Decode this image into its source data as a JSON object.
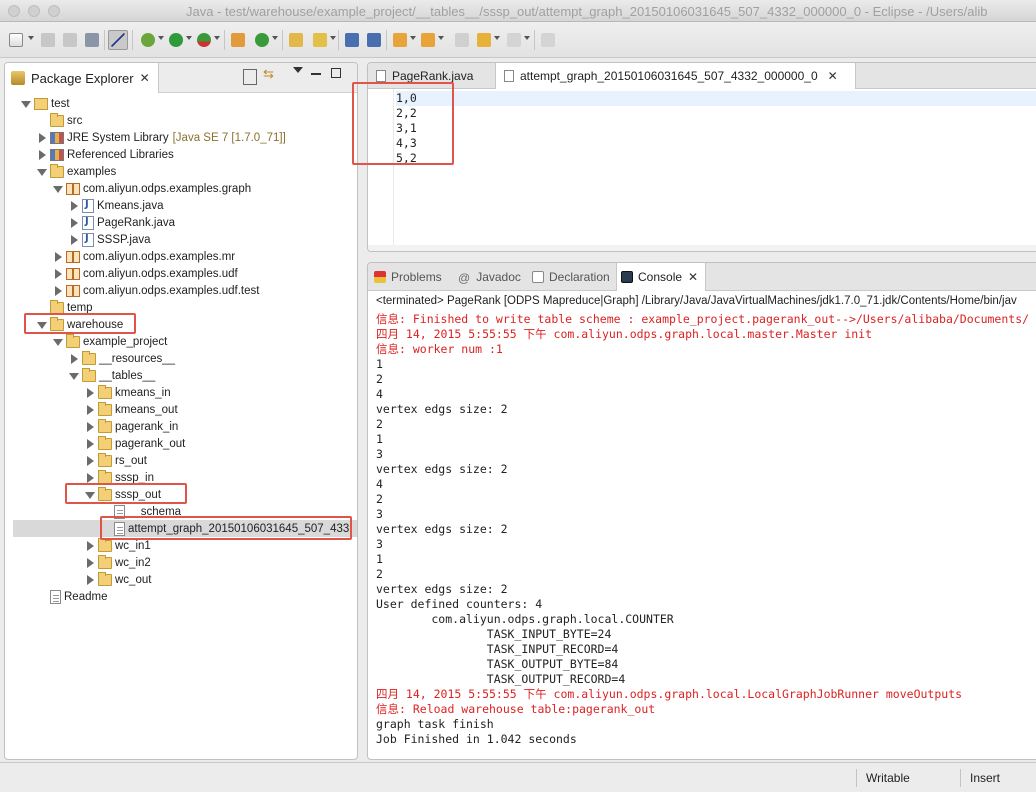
{
  "window": {
    "title": "Java - test/warehouse/example_project/__tables__/sssp_out/attempt_graph_20150106031645_507_4332_000000_0 - Eclipse - /Users/alib"
  },
  "package_explorer": {
    "tab_label": "Package Explorer",
    "tree": [
      {
        "label": "test",
        "icon": "project-icon",
        "twisty": "open"
      },
      {
        "label": "src",
        "icon": "source-folder-icon",
        "twisty": "none"
      },
      {
        "label": "JRE System Library",
        "suffix": "[Java SE 7 [1.7.0_71]]",
        "icon": "library-icon",
        "twisty": "closed"
      },
      {
        "label": "Referenced Libraries",
        "icon": "library-icon",
        "twisty": "closed"
      },
      {
        "label": "examples",
        "icon": "source-folder-icon",
        "twisty": "open"
      },
      {
        "label": "com.aliyun.odps.examples.graph",
        "icon": "package-icon",
        "twisty": "open"
      },
      {
        "label": "Kmeans.java",
        "icon": "java-file-icon",
        "twisty": "closed"
      },
      {
        "label": "PageRank.java",
        "icon": "java-file-icon",
        "twisty": "closed"
      },
      {
        "label": "SSSP.java",
        "icon": "java-file-icon",
        "twisty": "closed"
      },
      {
        "label": "com.aliyun.odps.examples.mr",
        "icon": "package-icon",
        "twisty": "closed"
      },
      {
        "label": "com.aliyun.odps.examples.udf",
        "icon": "package-icon",
        "twisty": "closed"
      },
      {
        "label": "com.aliyun.odps.examples.udf.test",
        "icon": "package-icon",
        "twisty": "closed"
      },
      {
        "label": "temp",
        "icon": "folder-icon",
        "twisty": "none"
      },
      {
        "label": "warehouse",
        "icon": "folder-icon",
        "twisty": "open"
      },
      {
        "label": "example_project",
        "icon": "folder-icon",
        "twisty": "open"
      },
      {
        "label": "__resources__",
        "icon": "folder-icon",
        "twisty": "closed"
      },
      {
        "label": "__tables__",
        "icon": "folder-icon",
        "twisty": "open"
      },
      {
        "label": "kmeans_in",
        "icon": "folder-icon",
        "twisty": "closed"
      },
      {
        "label": "kmeans_out",
        "icon": "folder-icon",
        "twisty": "closed"
      },
      {
        "label": "pagerank_in",
        "icon": "folder-icon",
        "twisty": "closed"
      },
      {
        "label": "pagerank_out",
        "icon": "folder-icon",
        "twisty": "closed"
      },
      {
        "label": "rs_out",
        "icon": "folder-icon",
        "twisty": "closed"
      },
      {
        "label": "sssp_in",
        "icon": "folder-icon",
        "twisty": "closed"
      },
      {
        "label": "sssp_out",
        "icon": "folder-icon",
        "twisty": "open"
      },
      {
        "label": "__schema__",
        "icon": "file-icon",
        "twisty": "none"
      },
      {
        "label": "attempt_graph_20150106031645_507_433",
        "icon": "file-icon",
        "twisty": "none",
        "selected": true
      },
      {
        "label": "wc_in1",
        "icon": "folder-icon",
        "twisty": "closed"
      },
      {
        "label": "wc_in2",
        "icon": "folder-icon",
        "twisty": "closed"
      },
      {
        "label": "wc_out",
        "icon": "folder-icon",
        "twisty": "closed"
      },
      {
        "label": "Readme",
        "icon": "file-icon",
        "twisty": "none"
      }
    ]
  },
  "editor": {
    "tabs": [
      {
        "label": "PageRank.java",
        "active": false
      },
      {
        "label": "attempt_graph_20150106031645_507_4332_000000_0",
        "active": true
      }
    ],
    "lines": [
      "1,0",
      "2,2",
      "3,1",
      "4,3",
      "5,2"
    ]
  },
  "console_panel": {
    "tabs": [
      {
        "label": "Problems",
        "icon": "problems-icon"
      },
      {
        "label": "Javadoc",
        "icon": "javadoc-icon"
      },
      {
        "label": "Declaration",
        "icon": "declaration-icon"
      },
      {
        "label": "Console",
        "icon": "console-icon",
        "active": true
      }
    ],
    "terminated": "<terminated> PageRank [ODPS Mapreduce|Graph] /Library/Java/JavaVirtualMachines/jdk1.7.0_71.jdk/Contents/Home/bin/jav",
    "lines": [
      {
        "text": "信息: Finished to write table scheme : example_project.pagerank_out-->/Users/alibaba/Documents/",
        "red": true
      },
      {
        "text": "四月 14, 2015 5:55:55 下午 com.aliyun.odps.graph.local.master.Master init",
        "red": true
      },
      {
        "text": "信息: worker num :1",
        "red": true
      },
      {
        "text": "1",
        "red": false
      },
      {
        "text": "2",
        "red": false
      },
      {
        "text": "4",
        "red": false
      },
      {
        "text": "vertex edgs size: 2",
        "red": false
      },
      {
        "text": "2",
        "red": false
      },
      {
        "text": "1",
        "red": false
      },
      {
        "text": "3",
        "red": false
      },
      {
        "text": "vertex edgs size: 2",
        "red": false
      },
      {
        "text": "4",
        "red": false
      },
      {
        "text": "2",
        "red": false
      },
      {
        "text": "3",
        "red": false
      },
      {
        "text": "vertex edgs size: 2",
        "red": false
      },
      {
        "text": "3",
        "red": false
      },
      {
        "text": "1",
        "red": false
      },
      {
        "text": "2",
        "red": false
      },
      {
        "text": "vertex edgs size: 2",
        "red": false
      },
      {
        "text": "User defined counters: 4",
        "red": false
      },
      {
        "text": "        com.aliyun.odps.graph.local.COUNTER",
        "red": false
      },
      {
        "text": "                TASK_INPUT_BYTE=24",
        "red": false
      },
      {
        "text": "                TASK_INPUT_RECORD=4",
        "red": false
      },
      {
        "text": "                TASK_OUTPUT_BYTE=84",
        "red": false
      },
      {
        "text": "                TASK_OUTPUT_RECORD=4",
        "red": false
      },
      {
        "text": "四月 14, 2015 5:55:55 下午 com.aliyun.odps.graph.local.LocalGraphJobRunner moveOutputs",
        "red": true
      },
      {
        "text": "信息: Reload warehouse table:pagerank_out",
        "red": true
      },
      {
        "text": "graph task finish",
        "red": false
      },
      {
        "text": "Job Finished in 1.042 seconds",
        "red": false
      }
    ]
  },
  "statusbar": {
    "mode": "Writable",
    "insert": "Insert"
  },
  "colors": {
    "highlight": "#e0554a",
    "console_error": "#dd2222"
  }
}
